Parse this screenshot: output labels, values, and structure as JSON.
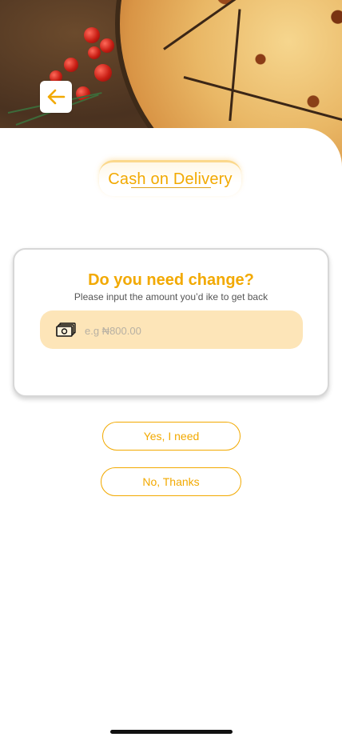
{
  "header": {
    "back_icon": "arrow-left-icon",
    "accent_color": "#f2a900"
  },
  "title": "Cash on Delivery",
  "change_card": {
    "heading": "Do you need change?",
    "subtitle": "Please input the amount you’d ike to get back",
    "amount_input": {
      "value": "",
      "placeholder": "e.g ₦800.00",
      "icon": "cash-icon"
    }
  },
  "actions": {
    "yes_label": "Yes, I need",
    "no_label": "No, Thanks"
  }
}
